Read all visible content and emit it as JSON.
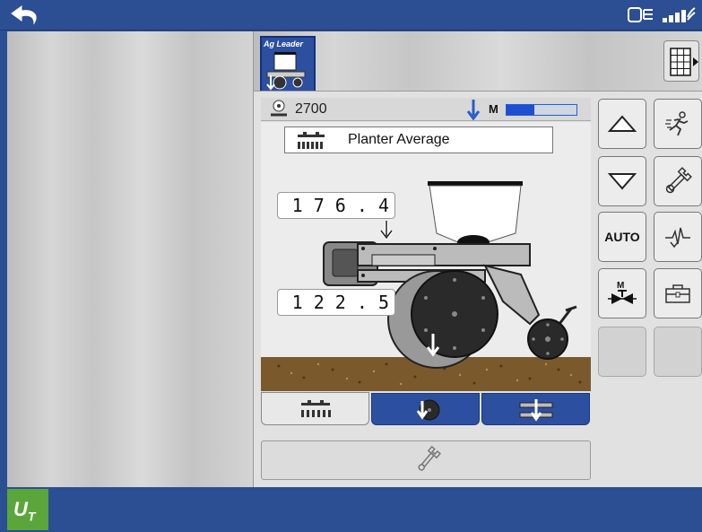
{
  "topbar": {
    "back_icon": "back-arrow-icon",
    "status_icons": [
      "implement-status-icon",
      "wifi-signal-icon"
    ]
  },
  "module": {
    "tab_label": "Ag Leader",
    "tab_icon": "planter-module-icon",
    "grid_icon": "grid-menu-icon"
  },
  "status": {
    "rate_value": "2700",
    "gauge_icon": "seed-rate-icon",
    "downforce_icon": "down-arrow-icon",
    "mode_letter": "M",
    "progress_fraction": 0.4
  },
  "display": {
    "selection_label": "Planter Average",
    "upper_value": "176.4",
    "lower_value": "122.5"
  },
  "view_tabs": [
    {
      "name": "planter-view-tab",
      "icon": "planter-rows-icon",
      "active": true
    },
    {
      "name": "gauge-wheel-tab",
      "icon": "gauge-wheel-icon",
      "active": false
    },
    {
      "name": "downforce-tab",
      "icon": "downforce-cylinder-icon",
      "active": false
    }
  ],
  "settings_bar_icon": "wrench-icon",
  "side_buttons": [
    {
      "name": "increase-button",
      "icon": "triangle-up-icon"
    },
    {
      "name": "run-button",
      "icon": "running-person-icon"
    },
    {
      "name": "decrease-button",
      "icon": "triangle-down-icon"
    },
    {
      "name": "tools-button",
      "icon": "wrench-icon"
    },
    {
      "name": "auto-button",
      "label": "AUTO"
    },
    {
      "name": "diagnostics-button",
      "icon": "pulse-icon"
    },
    {
      "name": "manual-valve-button",
      "icon": "manual-valve-icon"
    },
    {
      "name": "toolbox-button",
      "icon": "toolbox-icon"
    }
  ],
  "bottombar": {
    "logo_text": "U",
    "logo_sub": "T"
  },
  "colors": {
    "bar_blue": "#2c4e92",
    "active_blue": "#2d4fa0",
    "logo_green": "#5aa63a"
  }
}
